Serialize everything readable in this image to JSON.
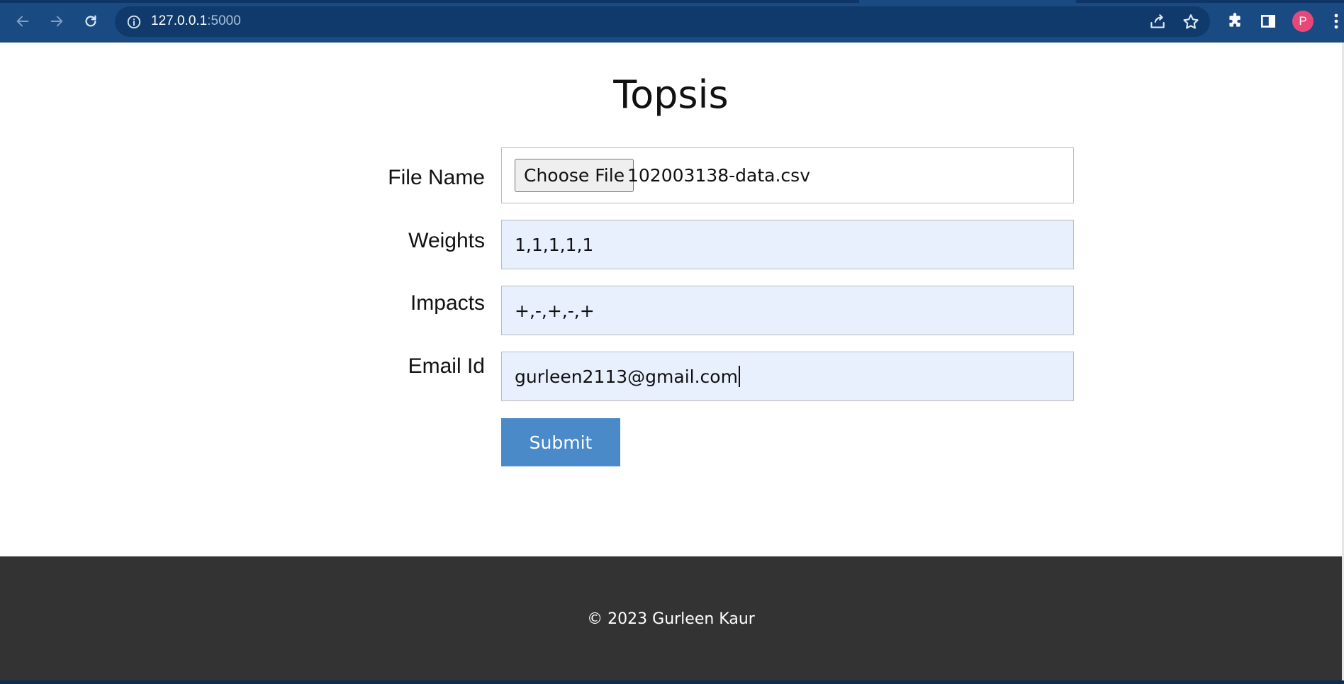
{
  "browser": {
    "url_host": "127.0.0.1",
    "url_port": ":5000",
    "profile_initial": "P",
    "icons": {
      "back": "arrow-left-icon",
      "forward": "arrow-right-icon",
      "reload": "reload-icon",
      "site_info": "info-icon",
      "share": "share-icon",
      "bookmark": "star-icon",
      "extensions": "puzzle-icon",
      "side_panel": "side-panel-icon",
      "menu": "kebab-menu-icon"
    },
    "colors": {
      "toolbar": "#1a4a82",
      "omnibox": "#0f3a6b",
      "avatar": "#e8477a"
    }
  },
  "page": {
    "title": "Topsis",
    "form": {
      "file_label": "File Name",
      "choose_file_label": "Choose File",
      "file_name": "102003138-data.csv",
      "weights_label": "Weights",
      "weights_value": "1,1,1,1,1",
      "impacts_label": "Impacts",
      "impacts_value": "+,-,+,-,+",
      "email_label": "Email Id",
      "email_value": "gurleen2113@gmail.com",
      "submit_label": "Submit"
    },
    "colors": {
      "submit": "#4a8ac8",
      "autofill_bg": "#e8f0fe",
      "footer_bg": "#333333"
    }
  },
  "footer": {
    "text": "© 2023 Gurleen Kaur"
  }
}
